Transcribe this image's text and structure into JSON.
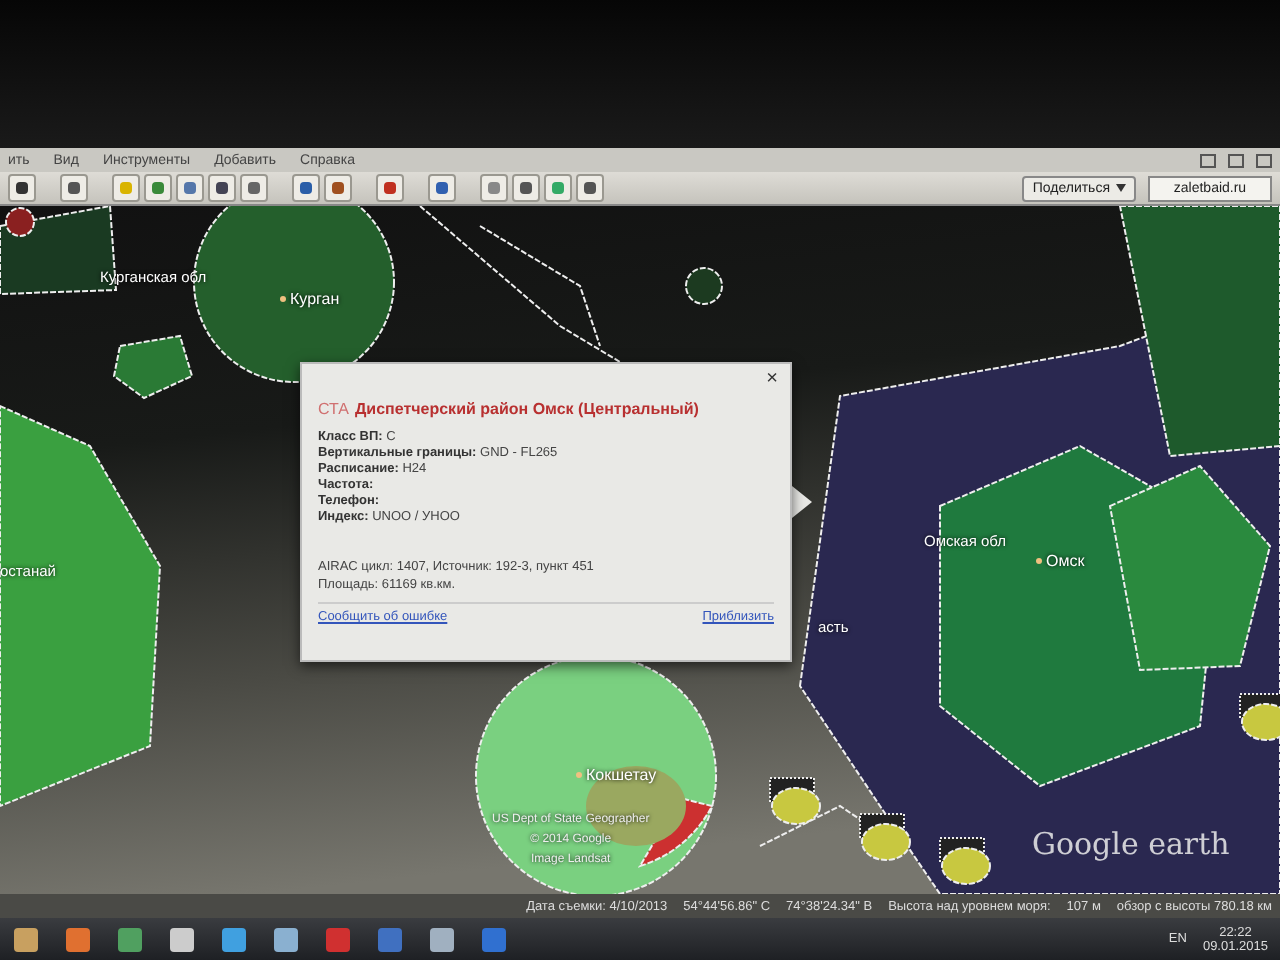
{
  "menu": [
    {
      "label": "ить"
    },
    {
      "label": "Вид"
    },
    {
      "label": "Инструменты"
    },
    {
      "label": "Добавить"
    },
    {
      "label": "Справка"
    }
  ],
  "toolbar": {
    "share_button": "Поделиться",
    "account": "zaletbaid.ru"
  },
  "map": {
    "labels": [
      {
        "text": "Курганская обл",
        "kind": "region"
      },
      {
        "text": "Курган",
        "kind": "city"
      },
      {
        "text": "останай",
        "kind": "region"
      },
      {
        "text": "асть",
        "kind": "region"
      },
      {
        "text": "Омская обл",
        "kind": "region"
      },
      {
        "text": "Омск",
        "kind": "city"
      },
      {
        "text": "Кокшетау",
        "kind": "city"
      }
    ],
    "attribution": [
      "US Dept of State Geographer",
      "© 2014 Google",
      "Image Landsat"
    ],
    "logo": "Google earth"
  },
  "popup": {
    "code": "СТА",
    "title": "Диспетчерский район Омск (Центральный)",
    "fields": [
      {
        "label": "Класс ВП:",
        "value": "C"
      },
      {
        "label": "Вертикальные границы:",
        "value": "GND - FL265"
      },
      {
        "label": "Расписание:",
        "value": "H24"
      },
      {
        "label": "Частота:"
      },
      {
        "label": "Телефон:"
      },
      {
        "label": "Индекс:",
        "value": "UNOO / УНОО"
      }
    ],
    "notes": [
      "AIRAC цикл: 1407, Источник: 192-3, пункт 451",
      "Площадь: 61169 кв.км."
    ],
    "report_link": "Сообщить об ошибке",
    "zoom_link": "Приблизить",
    "close": "×"
  },
  "status_bar": [
    "Дата съемки: 4/10/2013",
    "54°44'56.86\" С",
    "74°38'24.34\" В",
    "Высота над уровнем моря:",
    "107 м",
    "обзор с высоты 780.18 км"
  ],
  "taskbar": {
    "language": "EN",
    "time": "22:22",
    "date": "09.01.2015"
  }
}
